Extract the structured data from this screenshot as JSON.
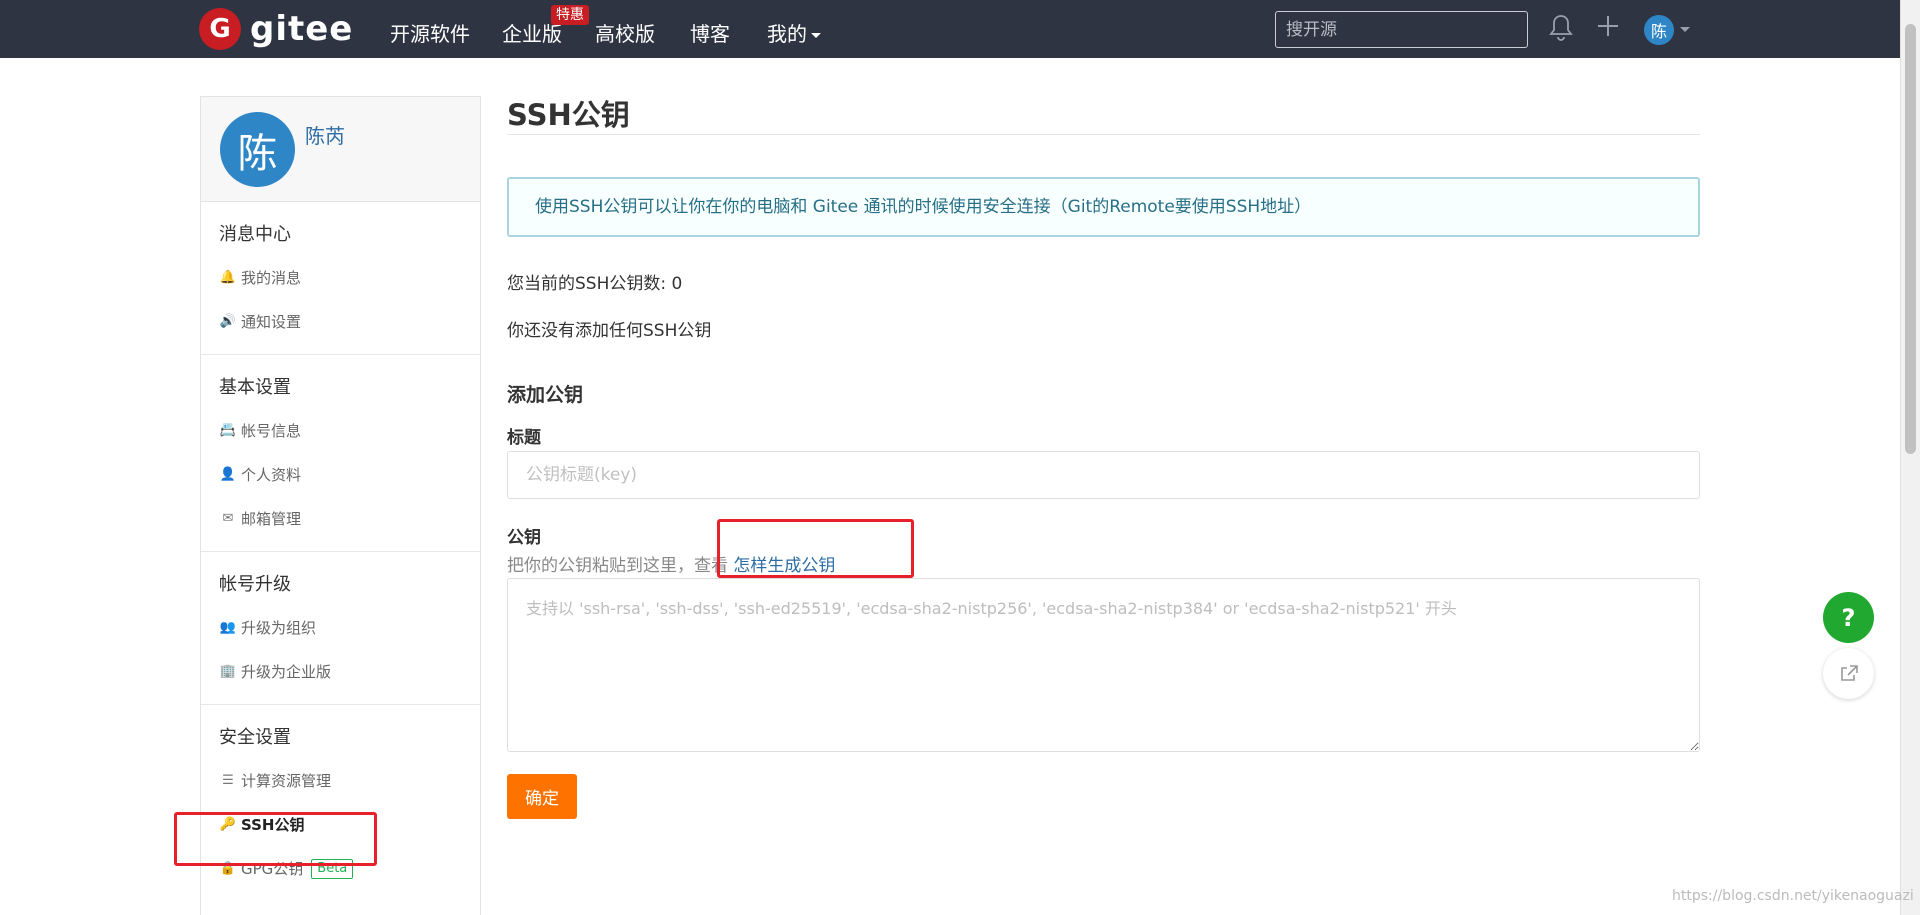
{
  "nav": {
    "logo_mark": "G",
    "logo_text": "gitee",
    "items": [
      {
        "label": "开源软件"
      },
      {
        "label": "企业版"
      },
      {
        "label": "高校版"
      },
      {
        "label": "博客"
      },
      {
        "label": "我的"
      }
    ],
    "enterprise_badge": "特惠",
    "search_placeholder": "搜开源",
    "bell_icon": "bell-icon",
    "plus_icon": "plus-icon",
    "avatar_text": "陈"
  },
  "sidebar": {
    "avatar_text": "陈",
    "user_name": "陈芮",
    "sections": [
      {
        "title": "消息中心",
        "items": [
          {
            "icon": "bell-icon",
            "label": "我的消息"
          },
          {
            "icon": "speaker-icon",
            "label": "通知设置"
          }
        ]
      },
      {
        "title": "基本设置",
        "items": [
          {
            "icon": "id-card-icon",
            "label": "帐号信息"
          },
          {
            "icon": "user-icon",
            "label": "个人资料"
          },
          {
            "icon": "envelope-icon",
            "label": "邮箱管理"
          }
        ]
      },
      {
        "title": "帐号升级",
        "items": [
          {
            "icon": "group-icon",
            "label": "升级为组织"
          },
          {
            "icon": "building-icon",
            "label": "升级为企业版"
          }
        ]
      },
      {
        "title": "安全设置",
        "items": [
          {
            "icon": "server-icon",
            "label": "计算资源管理"
          },
          {
            "icon": "key-icon",
            "label": "SSH公钥",
            "active": true
          },
          {
            "icon": "lock-icon",
            "label": "GPG公钥",
            "badge": "Beta"
          }
        ]
      }
    ]
  },
  "main": {
    "title": "SSH公钥",
    "info": "使用SSH公钥可以让你在你的电脑和 Gitee 通讯的时候使用安全连接（Git的Remote要使用SSH地址）",
    "count_text": "您当前的SSH公钥数: 0",
    "empty_text": "你还没有添加任何SSH公钥",
    "add_title": "添加公钥",
    "title_label": "标题",
    "title_placeholder": "公钥标题(key)",
    "key_label": "公钥",
    "hint_text": "把你的公钥粘贴到这里，查看 ",
    "hint_link": "怎样生成公钥",
    "key_placeholder": "支持以 'ssh-rsa', 'ssh-dss', 'ssh-ed25519', 'ecdsa-sha2-nistp256', 'ecdsa-sha2-nistp384' or 'ecdsa-sha2-nistp521' 开头",
    "submit_label": "确定"
  },
  "floating": {
    "help_label": "?",
    "share_icon": "external-link-icon"
  },
  "watermark": "https://blog.csdn.net/yikenaoguazi",
  "colors": {
    "nav_bg": "#2f3442",
    "brand_red": "#c71d23",
    "link_blue": "#2e6da4",
    "submit_orange": "#fe7300",
    "help_green": "#21a830",
    "annotation_red": "#e8202a"
  }
}
